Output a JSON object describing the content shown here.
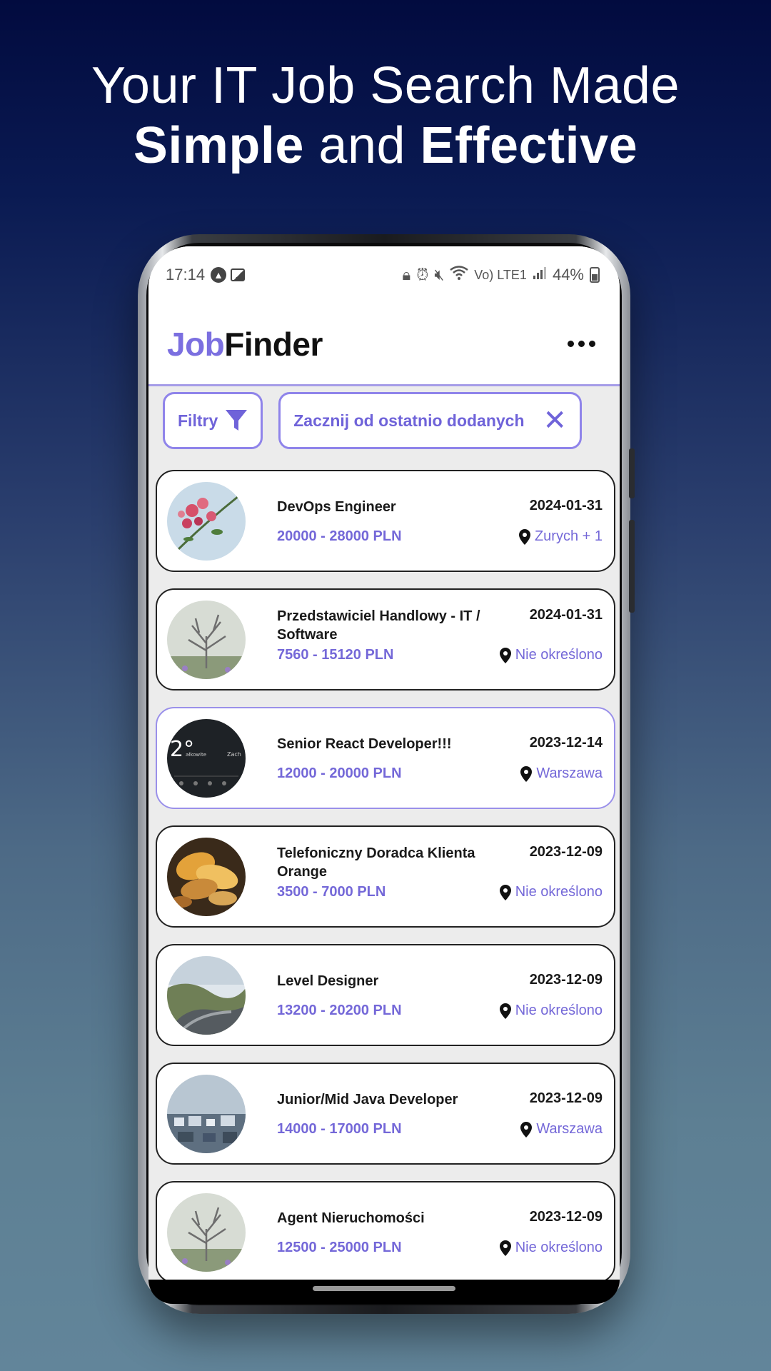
{
  "headline": {
    "line1": "Your IT Job Search Made",
    "bold1": "Simple",
    "mid": " and ",
    "bold2": "Effective"
  },
  "status_bar": {
    "time": "17:14",
    "battery": "44%",
    "network": "Vo) LTE1"
  },
  "app": {
    "brand_part1": "Job",
    "brand_part2": "Finder"
  },
  "filters": {
    "filter_label": "Filtry",
    "sort_label": "Zacznij od ostatnio dodanych"
  },
  "jobs": [
    {
      "title": "DevOps Engineer",
      "date": "2024-01-31",
      "salary": "20000 - 28000 PLN",
      "location": "Zurych + 1",
      "thumb": "flowers"
    },
    {
      "title": "Przedstawiciel Handlowy - IT / Software",
      "date": "2024-01-31",
      "salary": "7560 - 15120 PLN",
      "location": "Nie określono",
      "thumb": "tree"
    },
    {
      "title": "Senior React Developer!!!",
      "date": "2023-12-14",
      "salary": "12000 - 20000 PLN",
      "location": "Warszawa",
      "thumb": "weather-widget"
    },
    {
      "title": "Telefoniczny Doradca Klienta Orange",
      "date": "2023-12-09",
      "salary": "3500 - 7000 PLN",
      "location": "Nie określono",
      "thumb": "autumn-leaves"
    },
    {
      "title": "Level Designer",
      "date": "2023-12-09",
      "salary": "13200 - 20200 PLN",
      "location": "Nie określono",
      "thumb": "mountain-road"
    },
    {
      "title": "Junior/Mid Java Developer",
      "date": "2023-12-09",
      "salary": "14000 - 17000 PLN",
      "location": "Warszawa",
      "thumb": "city"
    },
    {
      "title": "Agent Nieruchomości",
      "date": "2023-12-09",
      "salary": "12500 - 25000 PLN",
      "location": "Nie określono",
      "thumb": "tree"
    }
  ],
  "thumb_widget": {
    "temp": "2°",
    "left_label": "ałkowite",
    "right_label": "Zach"
  },
  "colors": {
    "accent": "#7b6fe0",
    "background_top": "#020b3f",
    "background_bottom": "#62859a"
  }
}
